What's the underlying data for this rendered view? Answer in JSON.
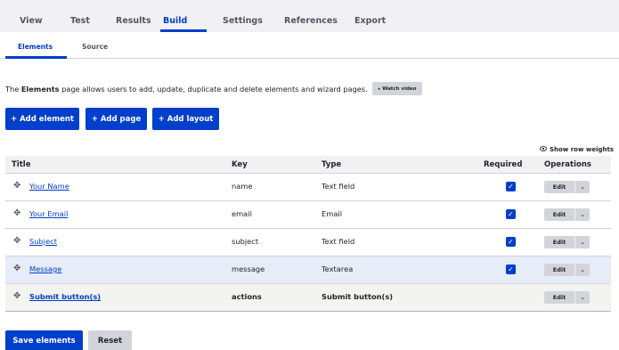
{
  "primary_tabs": [
    {
      "label": "View"
    },
    {
      "label": "Test"
    },
    {
      "label": "Results"
    },
    {
      "label": "Build"
    },
    {
      "label": "Settings"
    },
    {
      "label": "References"
    },
    {
      "label": "Export"
    }
  ],
  "active_primary_tab": "Build",
  "secondary_tabs": [
    {
      "label": "Elements"
    },
    {
      "label": "Source"
    }
  ],
  "active_secondary_tab": "Elements",
  "description": {
    "prefix": "The ",
    "bold": "Elements",
    "suffix": " page allows users to add, update, duplicate and delete elements and wizard pages.",
    "watch_video": "Watch video",
    "watch_video_icon": "▸"
  },
  "actions": {
    "add_element": "+ Add element",
    "add_page": "+ Add page",
    "add_layout": "+ Add layout"
  },
  "show_row_weights": "Show row weights",
  "show_row_weights_icon": "eye-icon",
  "table": {
    "headers": {
      "title": "Title",
      "key": "Key",
      "type": "Type",
      "required": "Required",
      "operations": "Operations"
    },
    "rows": [
      {
        "title": "Your Name",
        "key": "name",
        "type": "Text field",
        "required": true,
        "edit": "Edit"
      },
      {
        "title": "Your Email",
        "key": "email",
        "type": "Email",
        "required": true,
        "edit": "Edit"
      },
      {
        "title": "Subject",
        "key": "subject",
        "type": "Text field",
        "required": true,
        "edit": "Edit"
      },
      {
        "title": "Message",
        "key": "message",
        "type": "Textarea",
        "required": true,
        "edit": "Edit"
      },
      {
        "title": "Submit button(s)",
        "key": "actions",
        "type": "Submit button(s)",
        "required": false,
        "edit": "Edit"
      }
    ]
  },
  "footer": {
    "save": "Save elements",
    "reset": "Reset"
  },
  "colors": {
    "accent": "#003ecc",
    "tab_bar_bg": "#f1f1f4",
    "button_gray": "#d3d4d9",
    "row_highlight": "#e6ecf8"
  }
}
